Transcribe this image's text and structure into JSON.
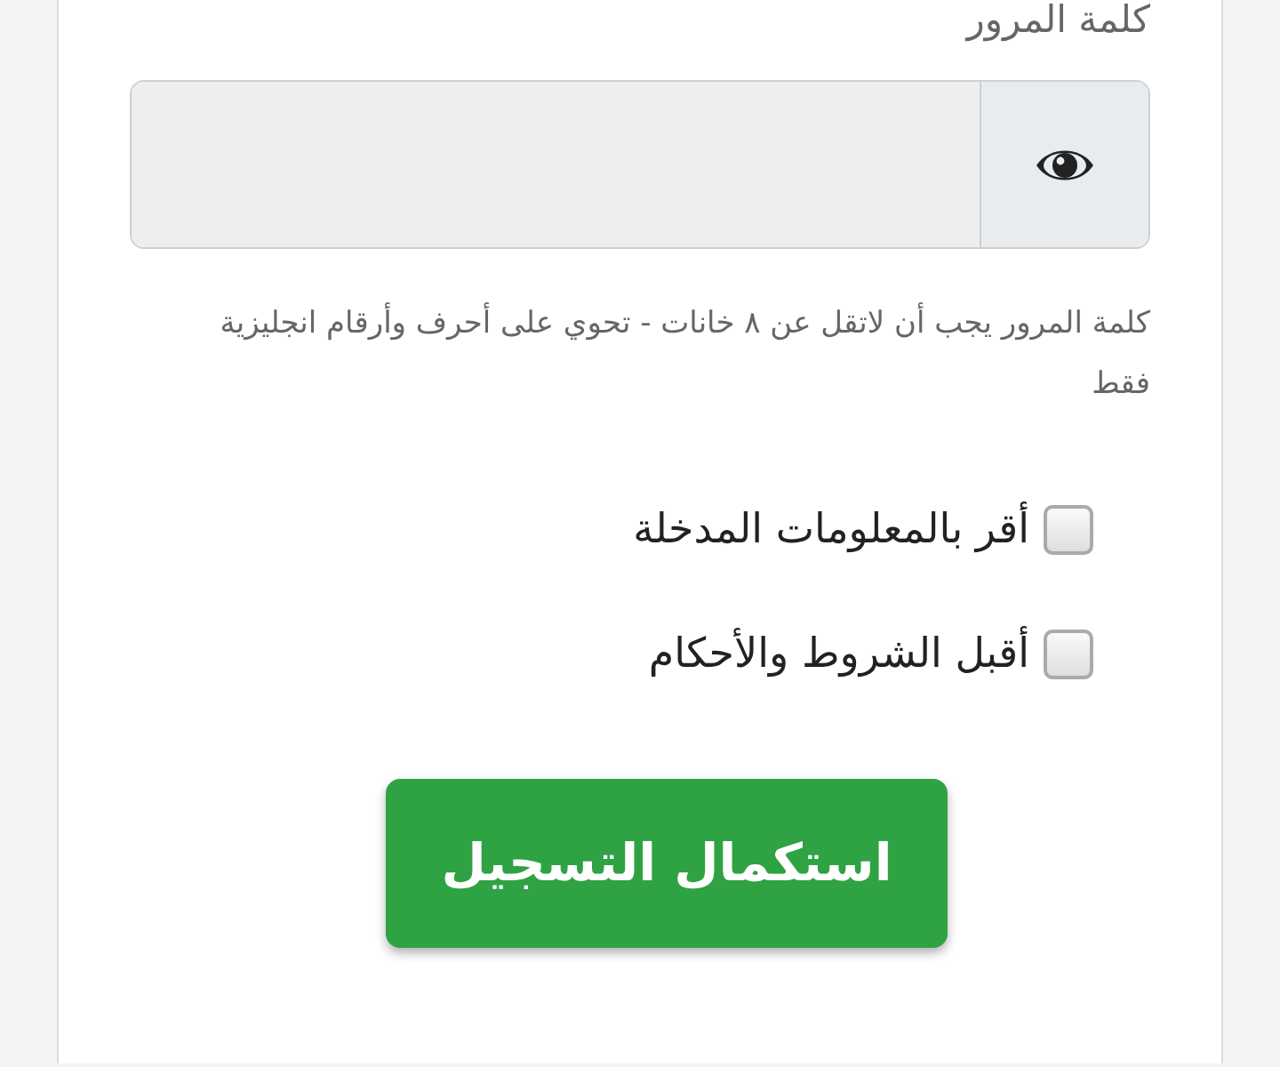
{
  "password": {
    "label": "كلمة المرور",
    "hint": "كلمة المرور يجب أن لاتقل عن ٨ خانات - تحوي على أحرف وأرقام انجليزية فقط"
  },
  "checkboxes": [
    {
      "label": "أقر بالمعلومات المدخلة",
      "checked": false
    },
    {
      "label": "أقبل الشروط والأحكام",
      "checked": false
    }
  ],
  "submit_button": "استكمال التسجيل"
}
